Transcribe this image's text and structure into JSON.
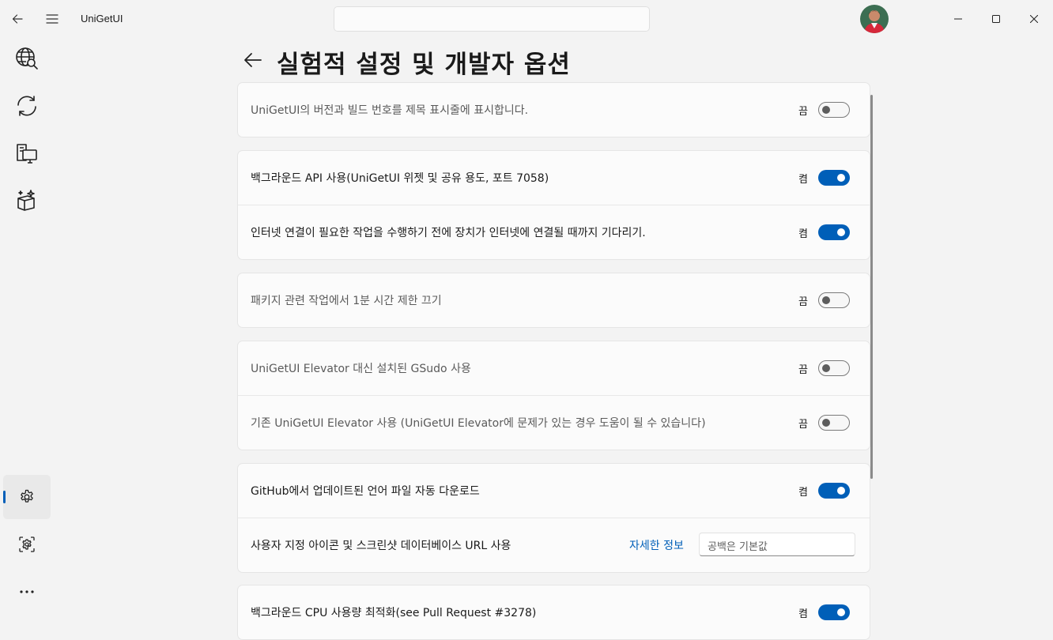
{
  "app": {
    "title": "UniGetUI"
  },
  "page": {
    "title": "실험적 설정 및 개발자 옵션"
  },
  "sidebar": {
    "items": [
      {
        "name": "discover",
        "icon": "globe-search-icon"
      },
      {
        "name": "updates",
        "icon": "sync-icon"
      },
      {
        "name": "installed",
        "icon": "installed-packages-icon"
      },
      {
        "name": "bundles",
        "icon": "sparkle-box-icon"
      },
      {
        "name": "settings",
        "icon": "gear-icon",
        "active": true
      },
      {
        "name": "managers",
        "icon": "gear-square-icon"
      },
      {
        "name": "more",
        "icon": "more-icon"
      }
    ]
  },
  "cards": [
    {
      "rows": [
        {
          "label": "UniGetUI의 버전과 빌드 번호를 제목 표시줄에 표시합니다.",
          "state": "끔",
          "on": false
        }
      ]
    },
    {
      "rows": [
        {
          "label": "백그라운드 API 사용(UniGetUI 위젯 및 공유 용도, 포트 7058)",
          "state": "켬",
          "on": true
        },
        {
          "label": "인터넷 연결이 필요한 작업을 수행하기 전에 장치가 인터넷에 연결될 때까지 기다리기.",
          "state": "켬",
          "on": true
        }
      ]
    },
    {
      "rows": [
        {
          "label": "패키지 관련 작업에서 1분 시간 제한 끄기",
          "state": "끔",
          "on": false
        }
      ]
    },
    {
      "rows": [
        {
          "label": "UniGetUI Elevator 대신 설치된 GSudo 사용",
          "state": "끔",
          "on": false
        },
        {
          "label": "기존 UniGetUI Elevator 사용 (UniGetUI Elevator에 문제가 있는 경우 도움이 될 수 있습니다)",
          "state": "끔",
          "on": false
        }
      ]
    },
    {
      "rows": [
        {
          "label": "GitHub에서 업데이트된 언어 파일 자동 다운로드",
          "state": "켬",
          "on": true
        },
        {
          "label": "사용자 지정 아이콘 및 스크린샷 데이터베이스 URL 사용",
          "link": "자세한 정보",
          "placeholder": "공백은 기본값"
        }
      ]
    },
    {
      "rows": [
        {
          "label": "백그라운드 CPU 사용량 최적화(see Pull Request #3278)",
          "state": "켬",
          "on": true
        }
      ]
    }
  ],
  "colors": {
    "accent": "#005fb8",
    "background": "#f3f3f3",
    "card": "#fbfbfb"
  }
}
